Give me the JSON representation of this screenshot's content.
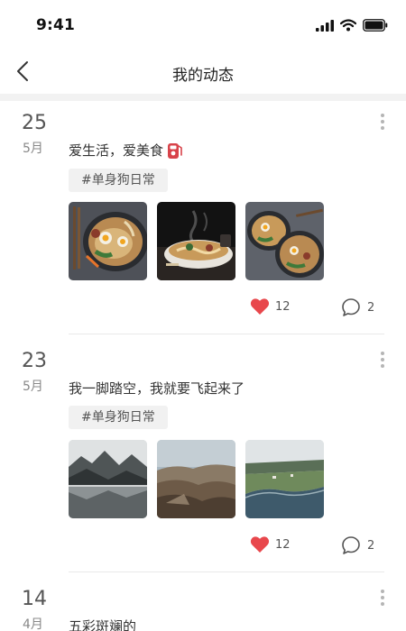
{
  "status_bar": {
    "time": "9:41"
  },
  "header": {
    "title": "我的动态"
  },
  "posts": [
    {
      "day": "25",
      "month": "5月",
      "text": "爱生活，爱美食",
      "emoji": "fuel-pump-icon",
      "tag": "#单身狗日常",
      "photos": [
        "ramen-bowl-photo",
        "noodle-bowl-steam-photo",
        "ramen-bowls-photo"
      ],
      "likes": "12",
      "comments": "2"
    },
    {
      "day": "23",
      "month": "5月",
      "text": "我一脚踏空，我就要飞起来了",
      "tag": "#单身狗日常",
      "photos": [
        "misty-lake-photo",
        "rocky-hills-photo",
        "coastline-aerial-photo"
      ],
      "likes": "12",
      "comments": "2"
    },
    {
      "day": "14",
      "month": "4月",
      "text": "五彩斑斓的"
    }
  ],
  "colors": {
    "like_red": "#e8474c",
    "tag_bg": "#f1f1f1",
    "divider": "#e9e9e9"
  }
}
